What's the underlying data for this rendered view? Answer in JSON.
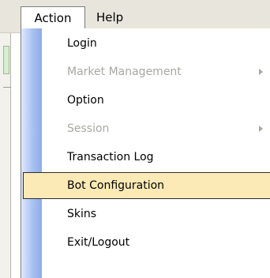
{
  "menubar": {
    "menus": [
      "Action",
      "Help"
    ]
  },
  "action_menu": {
    "items": [
      {
        "label": "Login",
        "enabled": true,
        "submenu": false
      },
      {
        "label": "Market Management",
        "enabled": false,
        "submenu": true
      },
      {
        "label": "Option",
        "enabled": true,
        "submenu": false
      },
      {
        "label": "Session",
        "enabled": false,
        "submenu": true
      },
      {
        "label": "Transaction Log",
        "enabled": true,
        "submenu": false
      },
      {
        "label": "Bot Configuration",
        "enabled": true,
        "submenu": false,
        "highlighted": true
      },
      {
        "label": "Skins",
        "enabled": true,
        "submenu": false
      },
      {
        "label": "Exit/Logout",
        "enabled": true,
        "submenu": false
      }
    ]
  },
  "colors": {
    "highlight": "#fbeab6",
    "disabled_text": "#a8a7a0",
    "gutter": "#a9c1f1"
  }
}
